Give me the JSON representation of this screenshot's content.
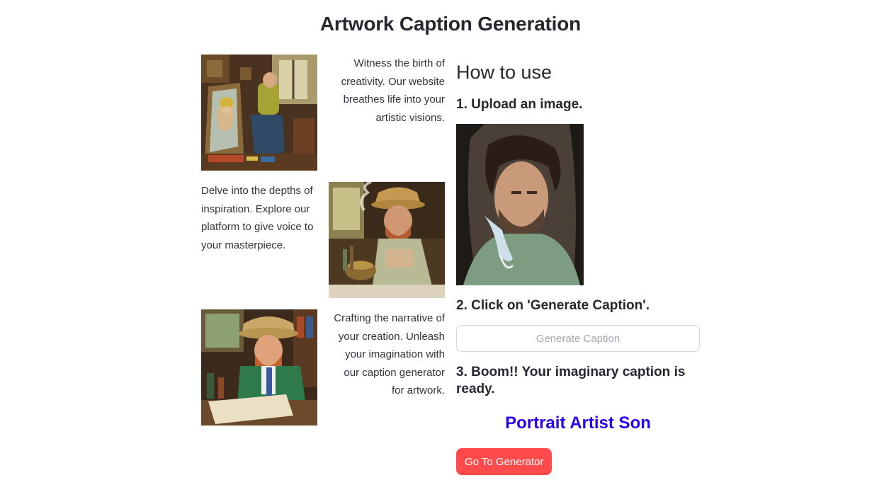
{
  "page": {
    "title": "Artwork Caption Generation"
  },
  "gallery": {
    "text_1": "Witness the birth of creativity. Our website breathes life into your artistic visions.",
    "text_2": "Delve into the depths of inspiration. Explore our platform to give voice to your masterpiece.",
    "text_3": "Crafting the narrative of your creation. Unleash your imagination with our caption generator for artwork."
  },
  "how_to_use": {
    "heading": "How to use",
    "step_1": "1. Upload an image.",
    "step_2": "2. Click on 'Generate Caption'.",
    "generate_button_label": "Generate Caption",
    "step_3": "3. Boom!! Your imaginary caption is ready.",
    "caption_result": "Portrait Artist Son",
    "go_button_label": "Go To Generator"
  },
  "colors": {
    "caption_result": "#2a00f0",
    "primary_button": "#ff4b4b",
    "disabled_text": "#a3a8b4",
    "title_text": "#262730"
  }
}
